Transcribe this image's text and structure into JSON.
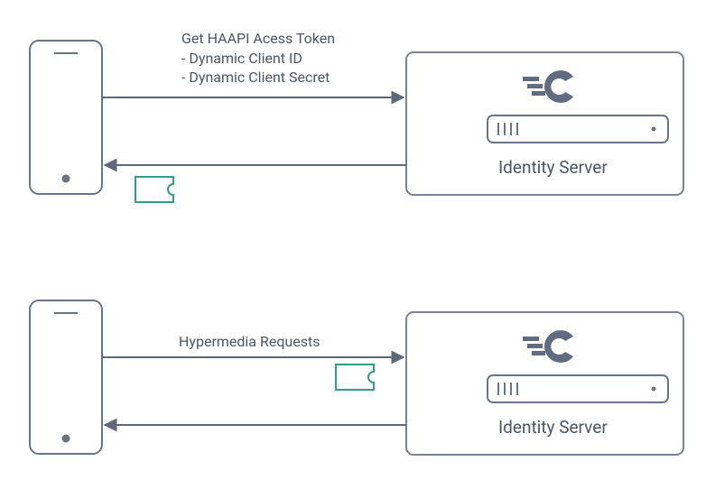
{
  "flow1": {
    "request_title": "Get HAAPI Acess Token",
    "request_line1": "- Dynamic Client ID",
    "request_line2": "- Dynamic Client Secret",
    "server_label": "Identity Server"
  },
  "flow2": {
    "request_title": "Hypermedia Requests",
    "server_label": "Identity Server"
  }
}
